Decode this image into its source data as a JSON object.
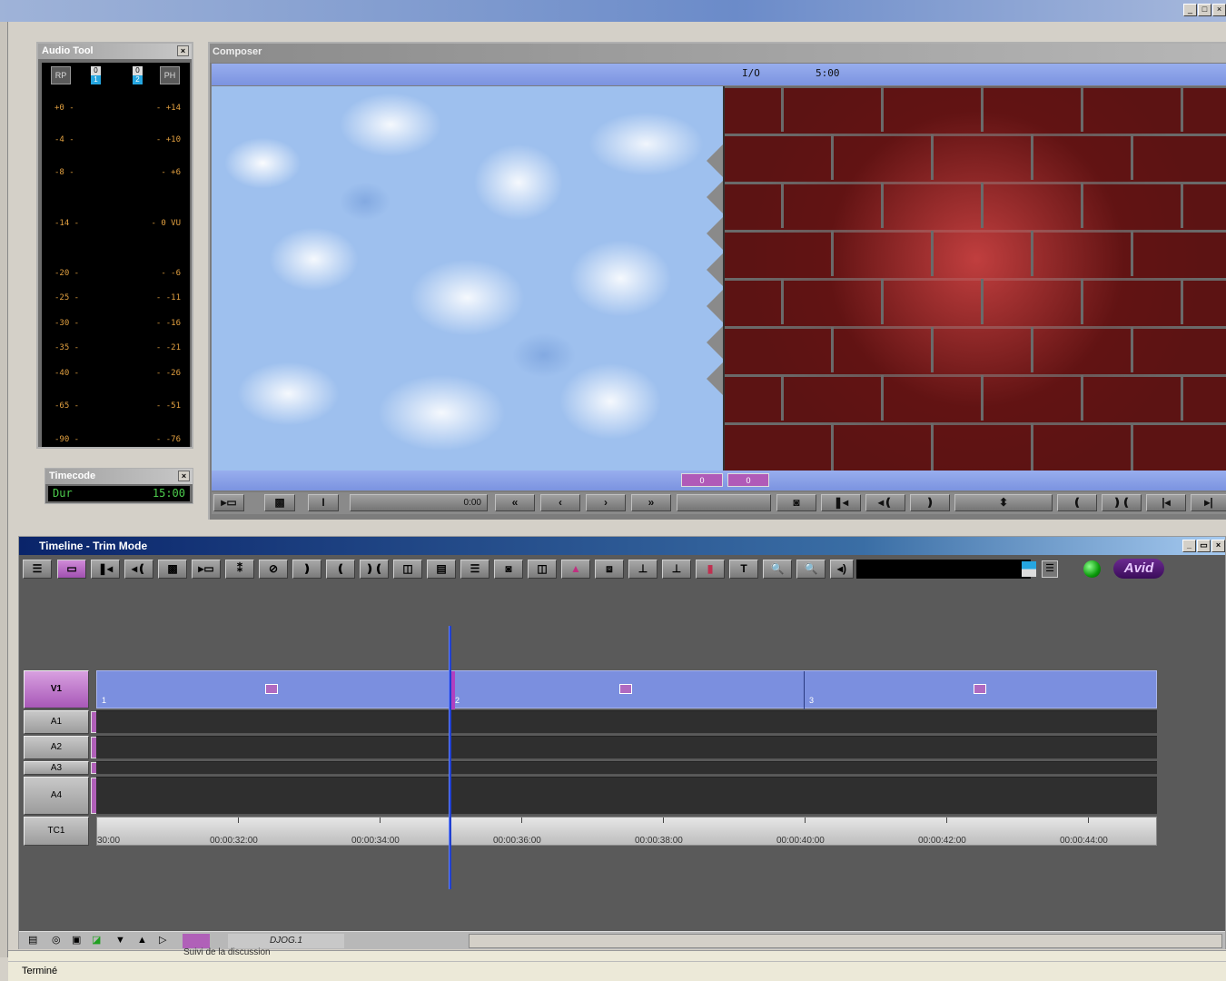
{
  "window": {
    "minimize": "_",
    "maximize": "□",
    "close": "×"
  },
  "audio_tool": {
    "title": "Audio Tool",
    "close": "×",
    "buttons": [
      "RP",
      "PH"
    ],
    "channels": [
      {
        "value": "0",
        "number": "1"
      },
      {
        "value": "0",
        "number": "2"
      }
    ],
    "left_scale": [
      "+0 -",
      "-4 -",
      "-8 -",
      "-14 -",
      "-20 -",
      "-25 -",
      "-30 -",
      "-35 -",
      "-40 -",
      "-65 -",
      "-90 -"
    ],
    "right_scale": [
      "- +14",
      "- +10",
      "- +6",
      "- 0 VU",
      "- -6",
      "- -11",
      "- -16",
      "- -21",
      "- -26",
      "- -51",
      "- -76"
    ]
  },
  "timecode": {
    "title": "Timecode",
    "close": "×",
    "label": "Dur",
    "value": "15:00"
  },
  "composer": {
    "title": "Composer",
    "info_io": "I/O",
    "info_dur": "5:00",
    "left_tc": "0",
    "right_tc": "0",
    "position": "0:00",
    "buttons": [
      "▸▭",
      "▩",
      "I",
      "«",
      "‹",
      "›",
      "»",
      "◙",
      "❚◂",
      "◂❪",
      "❫",
      "⬍",
      "❪",
      "❫❪",
      "|◂",
      "▸|"
    ]
  },
  "timeline": {
    "title": "Timeline - Trim Mode",
    "min": "_",
    "restore": "▭",
    "close": "×",
    "tool_buttons": [
      "☰",
      "▭",
      "❚◂",
      "◂❪",
      "▩",
      "▸▭",
      "⁑",
      "⊘",
      "❫",
      "❪",
      "❫❪",
      "◫",
      "▤",
      "☰",
      "◙",
      "◫",
      "▲",
      "⧈",
      "⊥",
      "⊥",
      "▮",
      "T",
      "🔍",
      "🔍",
      "◂)"
    ],
    "logo": "Avid",
    "tracks": [
      {
        "name": "V1"
      },
      {
        "name": "A1"
      },
      {
        "name": "A2"
      },
      {
        "name": "A3"
      },
      {
        "name": "A4"
      },
      {
        "name": "TC1"
      }
    ],
    "clips": [
      "1",
      "2",
      "3"
    ],
    "timecodes": [
      "30:00",
      "00:00:32:00",
      "00:00:34:00",
      "00:00:36:00",
      "00:00:38:00",
      "00:00:40:00",
      "00:00:42:00",
      "00:00:44:00"
    ],
    "sequence_name": "DJOG.1",
    "bottom_icons": [
      "▤",
      "◎",
      "▣",
      "◪",
      "▼",
      "▲",
      "▷"
    ]
  },
  "status": {
    "thread": "Suivi de la discussion",
    "text": "Terminé"
  },
  "colors": {
    "accent_purple": "#b05ab8",
    "track_blue": "#7b8fdf",
    "vu_text": "#e2a040",
    "timecode_green": "#4ccc4c"
  }
}
